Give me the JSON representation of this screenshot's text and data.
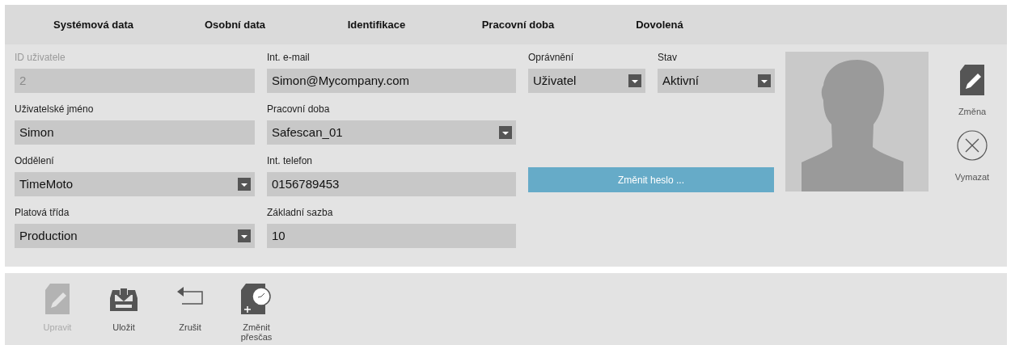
{
  "tabs": [
    {
      "label": "Systémová data"
    },
    {
      "label": "Osobní data"
    },
    {
      "label": "Identifikace"
    },
    {
      "label": "Pracovní doba"
    },
    {
      "label": "Dovolená"
    }
  ],
  "left_column": [
    {
      "label": "ID uživatele",
      "value": "2",
      "kind": "text",
      "disabled": true
    },
    {
      "label": "Uživatelské jméno",
      "value": "Simon",
      "kind": "text",
      "disabled": false
    },
    {
      "label": "Oddělení",
      "value": "TimeMoto",
      "kind": "select",
      "disabled": false
    },
    {
      "label": "Platová třída",
      "value": "Production",
      "kind": "select",
      "disabled": false
    }
  ],
  "middle_column": [
    {
      "label": "Int. e-mail",
      "value": "Simon@Mycompany.com",
      "kind": "text",
      "disabled": false
    },
    {
      "label": "Pracovní doba",
      "value": "Safescan_01",
      "kind": "select",
      "disabled": false
    },
    {
      "label": "Int. telefon",
      "value": "0156789453",
      "kind": "text",
      "disabled": false
    },
    {
      "label": "Základní sazba",
      "value": "10",
      "kind": "text",
      "disabled": false
    }
  ],
  "right_fields": [
    {
      "label": "Oprávnění",
      "value": "Uživatel",
      "kind": "select",
      "disabled": false
    },
    {
      "label": "Stav",
      "value": "Aktivní",
      "kind": "select",
      "disabled": false
    }
  ],
  "password_button": "Změnit heslo ...",
  "photo_actions": [
    {
      "label": "Změna",
      "kind": "edit"
    },
    {
      "label": "Vymazat",
      "kind": "delete"
    }
  ],
  "toolbar": [
    {
      "label": "Upravit",
      "kind": "edit",
      "disabled": true
    },
    {
      "label": "Uložit",
      "kind": "save",
      "disabled": false
    },
    {
      "label": "Zrušit",
      "kind": "cancel",
      "disabled": false
    },
    {
      "label": "Změnit přesčas",
      "kind": "overtime",
      "disabled": false
    }
  ]
}
